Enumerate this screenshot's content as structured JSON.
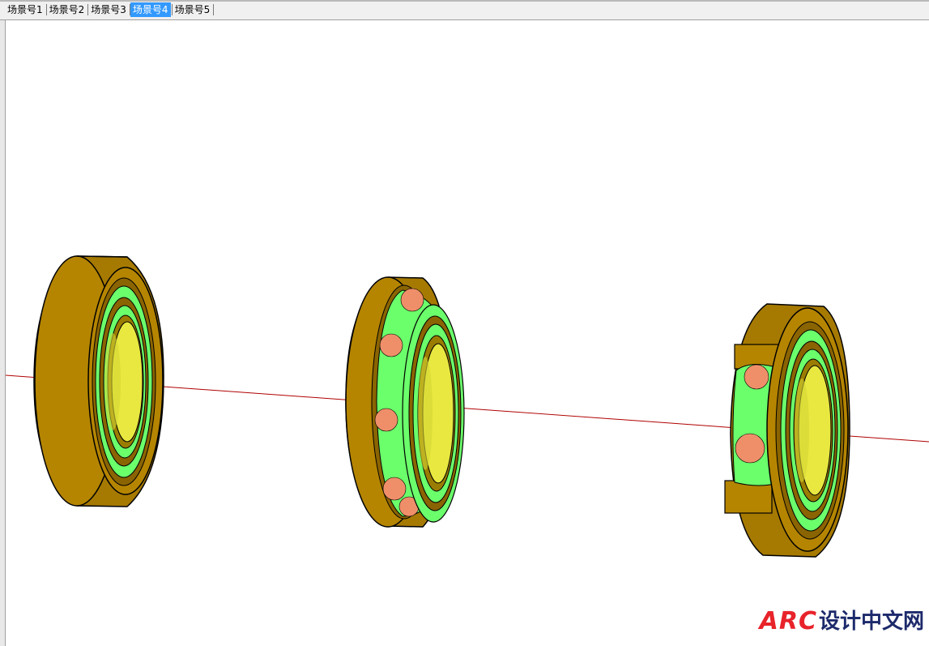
{
  "tabs": [
    {
      "label": "场景号1",
      "active": false
    },
    {
      "label": "场景号2",
      "active": false
    },
    {
      "label": "场景号3",
      "active": false
    },
    {
      "label": "场景号4",
      "active": true
    },
    {
      "label": "场景号5",
      "active": false
    }
  ],
  "scene": {
    "objects": [
      "full-bearing",
      "bearing-with-exposed-balls",
      "bearing-cutaway"
    ],
    "colors": {
      "outer_ring": "#b58500",
      "outer_ring_dark": "#8a6400",
      "cage": "#6bff6b",
      "inner_bore": "#e8e840",
      "balls": "#ef8f6a",
      "axis_line": "#b00000"
    }
  },
  "watermark": {
    "brand": "ARC",
    "text": "设计中文网"
  }
}
